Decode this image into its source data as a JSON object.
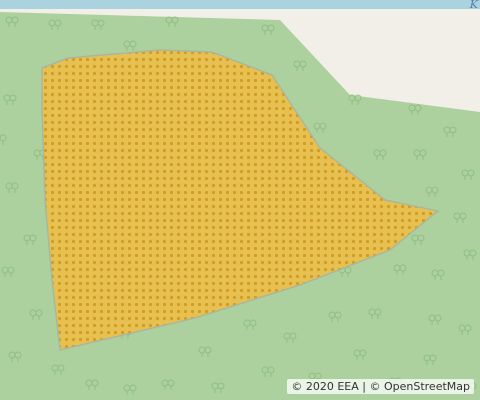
{
  "map": {
    "water_color": "#aad3df",
    "land_color": "#f2efe9",
    "forest_color": "#add19e",
    "forest_symbol_color": "#8fbf83",
    "parcel_fill_color": "#e4b43c",
    "parcel_dot_color": "#d69a1a",
    "parcel_stroke_color": "#a8b8a0",
    "forest_symbol": "tree-icon",
    "edge_label": "K"
  },
  "attribution": {
    "copyright_eea": "© 2020 EEA",
    "separator": "|",
    "copyright_osm_prefix": "©",
    "osm_link": "OpenStreetMap"
  }
}
